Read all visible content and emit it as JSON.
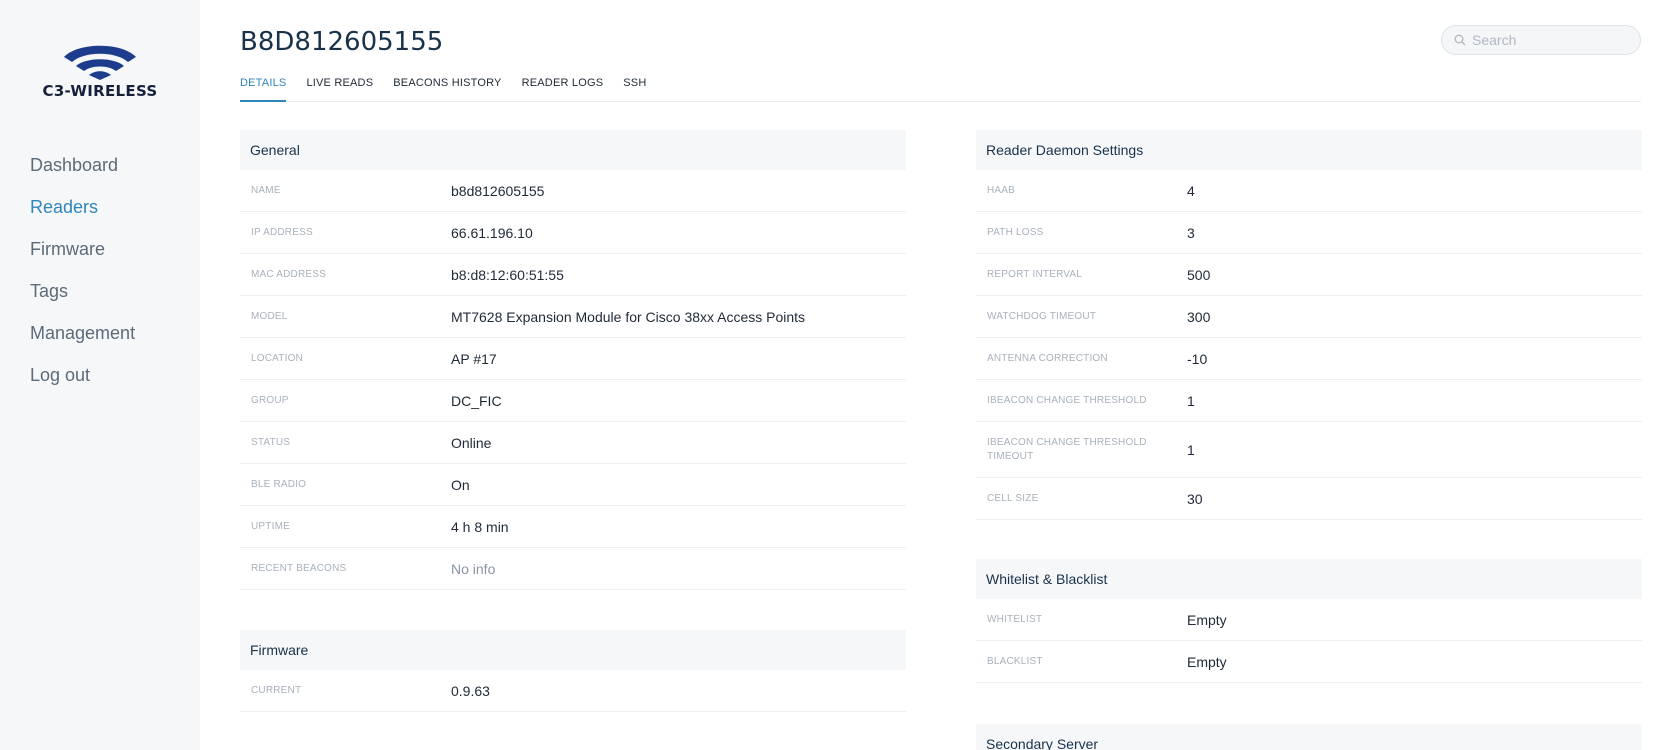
{
  "brand": {
    "logo_text": "C3-WIRELESS",
    "accent": "#2f86b8",
    "logo_color": "#1e3c8c"
  },
  "nav": {
    "items": [
      {
        "label": "Dashboard",
        "active": false
      },
      {
        "label": "Readers",
        "active": true
      },
      {
        "label": "Firmware",
        "active": false
      },
      {
        "label": "Tags",
        "active": false
      },
      {
        "label": "Management",
        "active": false
      },
      {
        "label": "Log out",
        "active": false
      }
    ]
  },
  "page": {
    "title": "B8D812605155"
  },
  "search": {
    "placeholder": "Search",
    "icon": "search-icon"
  },
  "tabs": [
    {
      "label": "DETAILS",
      "active": true
    },
    {
      "label": "LIVE READS",
      "active": false
    },
    {
      "label": "BEACONS HISTORY",
      "active": false
    },
    {
      "label": "READER LOGS",
      "active": false
    },
    {
      "label": "SSH",
      "active": false
    }
  ],
  "general": {
    "title": "General",
    "rows": [
      {
        "label": "NAME",
        "value": "b8d812605155"
      },
      {
        "label": "IP ADDRESS",
        "value": "66.61.196.10"
      },
      {
        "label": "MAC ADDRESS",
        "value": "b8:d8:12:60:51:55"
      },
      {
        "label": "MODEL",
        "value": "MT7628 Expansion Module for Cisco 38xx Access Points"
      },
      {
        "label": "LOCATION",
        "value": "AP #17"
      },
      {
        "label": "GROUP",
        "value": "DC_FIC"
      },
      {
        "label": "STATUS",
        "value": "Online"
      },
      {
        "label": "BLE RADIO",
        "value": "On"
      },
      {
        "label": "UPTIME",
        "value": "4 h 8 min"
      },
      {
        "label": "RECENT BEACONS",
        "value": "No info"
      }
    ]
  },
  "firmware": {
    "title": "Firmware",
    "rows": [
      {
        "label": "CURRENT",
        "value": "0.9.63"
      }
    ]
  },
  "daemon": {
    "title": "Reader Daemon Settings",
    "rows": [
      {
        "label": "HAAB",
        "value": "4"
      },
      {
        "label": "PATH LOSS",
        "value": "3"
      },
      {
        "label": "REPORT INTERVAL",
        "value": "500"
      },
      {
        "label": "WATCHDOG TIMEOUT",
        "value": "300"
      },
      {
        "label": "ANTENNA CORRECTION",
        "value": "-10"
      },
      {
        "label": "IBEACON CHANGE THRESHOLD",
        "value": "1"
      },
      {
        "label": "IBEACON CHANGE THRESHOLD TIMEOUT",
        "value": "1"
      },
      {
        "label": "CELL SIZE",
        "value": "30"
      }
    ]
  },
  "lists": {
    "title": "Whitelist & Blacklist",
    "rows": [
      {
        "label": "WHITELIST",
        "value": "Empty"
      },
      {
        "label": "BLACKLIST",
        "value": "Empty"
      }
    ]
  },
  "secondary": {
    "title": "Secondary Server"
  }
}
